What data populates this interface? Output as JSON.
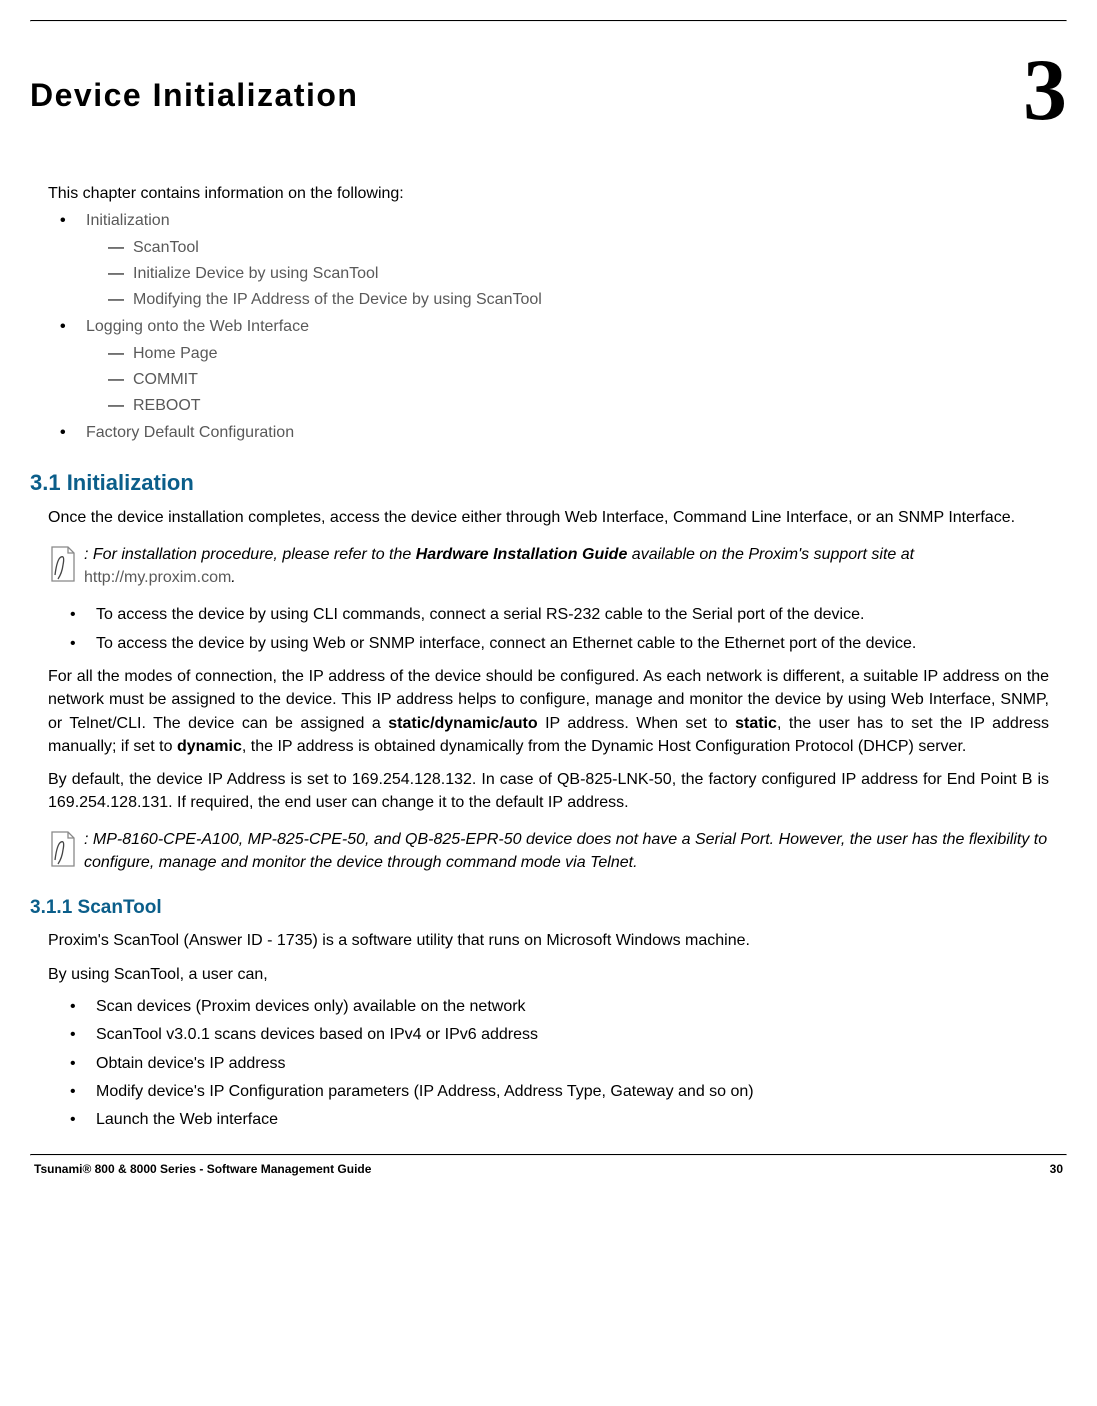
{
  "chapter": {
    "title": "Device Initialization",
    "number": "3"
  },
  "intro": "This chapter contains information on the following:",
  "toc": {
    "item1": "Initialization",
    "item1_sub1": "ScanTool",
    "item1_sub2": "Initialize Device by using ScanTool",
    "item1_sub3": "Modifying the IP Address of the Device by using ScanTool",
    "item2": "Logging onto the Web Interface",
    "item2_sub1": "Home Page",
    "item2_sub2": "COMMIT",
    "item2_sub3": "REBOOT",
    "item3": "Factory Default Configuration"
  },
  "section_3_1": {
    "heading": "3.1 Initialization",
    "para1": "Once the device installation completes, access the device either through Web Interface, Command Line Interface, or an SNMP Interface.",
    "note1_prefix": ": For installation procedure, please refer to the ",
    "note1_bold": "Hardware Installation Guide",
    "note1_mid": " available on the Proxim's support site at ",
    "note1_link": "http://my.proxim.com",
    "note1_suffix": ".",
    "access_list": {
      "a": "To access the device by using CLI commands, connect a serial RS-232 cable to the Serial port of the device.",
      "b": "To access the device by using Web or SNMP interface, connect an Ethernet cable to the Ethernet port of the device."
    },
    "para2_a": "For all the modes of connection, the IP address of the device should be configured. As each network is different, a suitable IP address on the network must be assigned to the device. This IP address helps to configure, manage and monitor the device by using Web Interface, SNMP, or Telnet/CLI. The device can be assigned a ",
    "para2_bold1": "static/dynamic/auto",
    "para2_b": " IP address. When set to ",
    "para2_bold2": "static",
    "para2_c": ", the user has to set the IP address manually; if set to ",
    "para2_bold3": "dynamic",
    "para2_d": ", the IP address is obtained dynamically from the Dynamic Host Configuration Protocol (DHCP) server.",
    "para3": "By default, the device IP Address is set to 169.254.128.132. In case of QB-825-LNK-50, the factory configured IP address for End Point B is 169.254.128.131. If required, the end user can change it to the default IP address.",
    "note2": ": MP-8160-CPE-A100, MP-825-CPE-50, and QB-825-EPR-50 device does not have a Serial Port. However, the user has the flexibility to configure, manage and monitor the device through command mode via Telnet."
  },
  "section_3_1_1": {
    "heading": "3.1.1 ScanTool",
    "para1": "Proxim's ScanTool (Answer ID - 1735) is a software utility that runs on Microsoft Windows machine.",
    "para2": "By using ScanTool, a user can,",
    "list": {
      "a": "Scan devices (Proxim devices only) available on the network",
      "b": "ScanTool v3.0.1 scans devices based on IPv4 or IPv6 address",
      "c": "Obtain device's IP address",
      "d": "Modify device's IP Configuration parameters (IP Address, Address Type, Gateway and so on)",
      "e": "Launch the Web interface"
    }
  },
  "footer": {
    "left": "Tsunami® 800 & 8000 Series - Software Management Guide",
    "right": "30"
  }
}
